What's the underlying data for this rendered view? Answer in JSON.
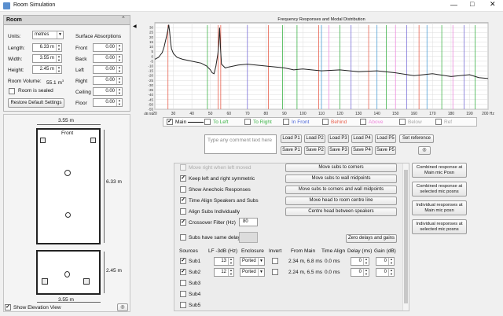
{
  "window": {
    "title": "Room Simulation"
  },
  "room": {
    "header": "Room",
    "units_label": "Units:",
    "units_value": "metres",
    "length_label": "Length:",
    "length_value": "6.33 m",
    "width_label": "Width:",
    "width_value": "3.55 m",
    "height_label": "Height:",
    "height_value": "2.45 m",
    "volume_label": "Room Volume:",
    "volume_value": "55.1 m",
    "volume_sup": "3",
    "sealed_label": "Room is sealed",
    "restore_label": "Restore Default Settings",
    "surface_title": "Surface Absorptions",
    "surfaces": [
      {
        "label": "Front",
        "value": "0.00"
      },
      {
        "label": "Back",
        "value": "0.00"
      },
      {
        "label": "Left",
        "value": "0.00"
      },
      {
        "label": "Right",
        "value": "0.00"
      },
      {
        "label": "Ceiling",
        "value": "0.00"
      },
      {
        "label": "Floor",
        "value": "0.00"
      }
    ]
  },
  "plan": {
    "width_label": "3.55 m",
    "length_label": "6.33 m",
    "front_label": "Front",
    "height_label": "2.45 m",
    "elev_width_label": "3.55 m",
    "show_elevation": "Show Elevation View"
  },
  "chart_data": {
    "type": "line",
    "title": "Frequency Responses and Modal Distribution",
    "xlabel": "Hz",
    "ylabel": "dB",
    "xlim": [
      20,
      200
    ],
    "ylim": [
      -55,
      35
    ],
    "x_ticks": [
      "20",
      "30",
      "40",
      "50",
      "60",
      "70",
      "80",
      "90",
      "100",
      "110",
      "120",
      "130",
      "140",
      "150",
      "160",
      "170",
      "180",
      "190",
      "200 Hz"
    ],
    "y_ticks": [
      "30",
      "25",
      "20",
      "15",
      "10",
      "5",
      "0",
      "-5",
      "-10",
      "-15",
      "-20",
      "-25",
      "-30",
      "-35",
      "-40",
      "-45",
      "-50",
      "-55"
    ],
    "y_unit_label": "dB 55",
    "series": [
      {
        "name": "Main",
        "color": "#222222",
        "x": [
          20,
          22,
          24,
          25,
          26,
          27,
          27.5,
          28,
          28.5,
          29,
          30,
          32,
          35,
          40,
          45,
          48,
          50,
          51,
          52,
          53,
          54,
          54.5,
          55,
          55.5,
          56,
          57,
          58,
          60,
          65,
          70,
          80,
          90,
          95,
          100,
          110,
          120,
          130,
          140,
          150,
          160,
          170,
          180,
          190,
          195,
          200
        ],
        "y": [
          -3,
          -1,
          4,
          10,
          18,
          27,
          33,
          26,
          15,
          8,
          3,
          -1,
          -3,
          -5,
          -7,
          -10,
          -14,
          -17,
          -18,
          -10,
          2,
          12,
          30,
          8,
          -8,
          -10,
          -12,
          -11,
          -9,
          -8,
          -10,
          -12,
          -14,
          -13,
          -15,
          -14,
          -16,
          -15,
          -17,
          -20,
          -18,
          -21,
          -19,
          -22,
          -23
        ]
      }
    ],
    "modes": [
      {
        "hz": 27.1,
        "color": "#e8614f"
      },
      {
        "hz": 48.4,
        "color": "#3fb44a"
      },
      {
        "hz": 54.2,
        "color": "#e8614f"
      },
      {
        "hz": 55.6,
        "color": "#e8614f"
      },
      {
        "hz": 70,
        "color": "#7a6fd8"
      },
      {
        "hz": 81.3,
        "color": "#e8614f"
      },
      {
        "hz": 89,
        "color": "#3fb44a"
      },
      {
        "hz": 96.8,
        "color": "#3fb44a"
      },
      {
        "hz": 108.5,
        "color": "#e8614f"
      },
      {
        "hz": 110,
        "color": "#4fa0d8"
      },
      {
        "hz": 114,
        "color": "#ee88dd"
      },
      {
        "hz": 120,
        "color": "#3fb44a"
      },
      {
        "hz": 126,
        "color": "#7a6fd8"
      },
      {
        "hz": 135.5,
        "color": "#e8614f"
      },
      {
        "hz": 140,
        "color": "#4fa0d8"
      },
      {
        "hz": 145,
        "color": "#3fb44a"
      },
      {
        "hz": 150,
        "color": "#ee88dd"
      },
      {
        "hz": 156,
        "color": "#7a6fd8"
      },
      {
        "hz": 162.7,
        "color": "#e8614f"
      },
      {
        "hz": 167,
        "color": "#4fa0d8"
      },
      {
        "hz": 175,
        "color": "#3fb44a"
      },
      {
        "hz": 181,
        "color": "#ee88dd"
      },
      {
        "hz": 187,
        "color": "#7a6fd8"
      },
      {
        "hz": 193,
        "color": "#3fb44a"
      }
    ]
  },
  "legend": [
    {
      "label": "Main",
      "color": "#111111",
      "checked": true,
      "line": true
    },
    {
      "label": "To Left",
      "color": "#3fb44a",
      "checked": false
    },
    {
      "label": "To Right",
      "color": "#3fb44a",
      "checked": false
    },
    {
      "label": "In Front",
      "color": "#4a64d8",
      "checked": false
    },
    {
      "label": "Behind",
      "color": "#e8614f",
      "checked": false
    },
    {
      "label": "Above",
      "color": "#ee88dd",
      "checked": false
    },
    {
      "label": "Below",
      "color": "#aaaaaa",
      "checked": false
    },
    {
      "label": "Ref",
      "color": "#aaaaaa",
      "checked": false
    }
  ],
  "comment": {
    "placeholder": "Type any comment text here"
  },
  "presets": {
    "load": [
      "Load P1",
      "Load P2",
      "Load P3",
      "Load P4",
      "Load P5"
    ],
    "save": [
      "Save P1",
      "Save P2",
      "Save P3",
      "Save P4",
      "Save P5"
    ],
    "set_reference": "Set reference"
  },
  "options": {
    "move_right": "Move right when left moved",
    "keep_symmetric": "Keep left and right symmetric",
    "show_anechoic": "Show Anechoic Responses",
    "time_align": "Time Align Speakers and Subs",
    "align_subs": "Align Subs Individually",
    "crossover_label": "Crossover Filter (Hz)",
    "crossover_value": "80",
    "same_delay": "Subs have same delay"
  },
  "actions": {
    "to_corners": "Move subs to corners",
    "to_wall_mid": "Move subs to wall midpoints",
    "to_corners_mid": "Move subs to corners and wall midpoints",
    "head_centre": "Move head to room centre line",
    "centre_head": "Centre head between speakers",
    "zero_delays": "Zero delays and gains"
  },
  "subs": {
    "headers": {
      "sources": "Sources",
      "lf": "LF -3dB (Hz)",
      "enclosure": "Enclosure",
      "invert": "Invert",
      "from_main": "From Main",
      "time_align": "Time Align",
      "delay": "Delay (ms)",
      "gain": "Gain (dB)"
    },
    "rows": [
      {
        "name": "Sub1",
        "checked": true,
        "lf": "13",
        "enclosure": "Ported",
        "from_main": "2.34 m, 6.8 ms",
        "time_align": "0.0 ms",
        "delay": "0",
        "gain": "0"
      },
      {
        "name": "Sub2",
        "checked": true,
        "lf": "12",
        "enclosure": "Ported",
        "from_main": "2.24 m, 6.5 ms",
        "time_align": "0.0 ms",
        "delay": "0",
        "gain": "0"
      },
      {
        "name": "Sub3",
        "checked": false
      },
      {
        "name": "Sub4",
        "checked": false
      },
      {
        "name": "Sub5",
        "checked": false
      }
    ]
  },
  "combined": [
    "Combined response at Main mic Posn",
    "Combined response at selected mic posns",
    "Individual responses at Main mic posn",
    "Individual responses at selected mic posns"
  ]
}
